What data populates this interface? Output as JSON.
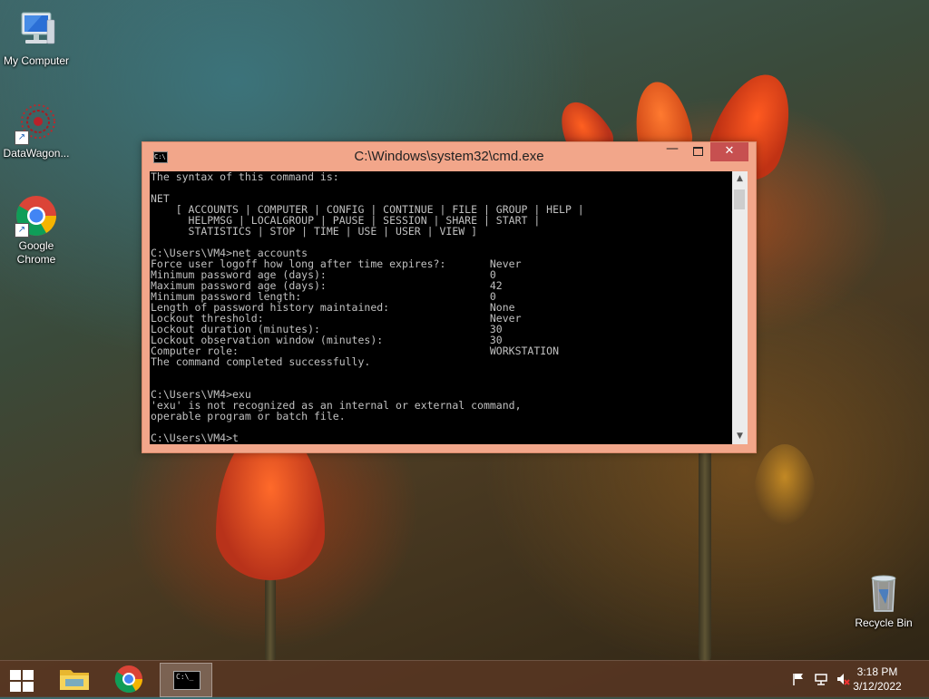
{
  "desktop": {
    "icons": [
      {
        "label": "My Computer"
      },
      {
        "label": "DataWagon..."
      },
      {
        "label": "Google Chrome"
      },
      {
        "label": "Recycle Bin"
      }
    ]
  },
  "window": {
    "title": "C:\\Windows\\system32\\cmd.exe",
    "icon_text": "C:\\",
    "minimize_glyph": "—",
    "close_glyph": "✕",
    "scroll_up_glyph": "▲",
    "scroll_down_glyph": "▼",
    "console_text": "The syntax of this command is:\n\nNET\n    [ ACCOUNTS | COMPUTER | CONFIG | CONTINUE | FILE | GROUP | HELP |\n      HELPMSG | LOCALGROUP | PAUSE | SESSION | SHARE | START |\n      STATISTICS | STOP | TIME | USE | USER | VIEW ]\n\nC:\\Users\\VM4>net accounts\nForce user logoff how long after time expires?:       Never\nMinimum password age (days):                          0\nMaximum password age (days):                          42\nMinimum password length:                              0\nLength of password history maintained:                None\nLockout threshold:                                    Never\nLockout duration (minutes):                           30\nLockout observation window (minutes):                 30\nComputer role:                                        WORKSTATION\nThe command completed successfully.\n\n\nC:\\Users\\VM4>exu\n'exu' is not recognized as an internal or external command,\noperable program or batch file.\n\nC:\\Users\\VM4>t"
  },
  "taskbar": {
    "cmd_icon_text": "C:\\_",
    "clock": {
      "time": "3:18 PM",
      "date": "3/12/2022"
    },
    "tray_icons": [
      "flag-icon",
      "network-icon",
      "volume-muted-icon"
    ]
  },
  "colors": {
    "window_frame": "#f2a68a",
    "close_button": "#c75050",
    "console_bg": "#000000",
    "console_text": "#c0c0c0"
  }
}
